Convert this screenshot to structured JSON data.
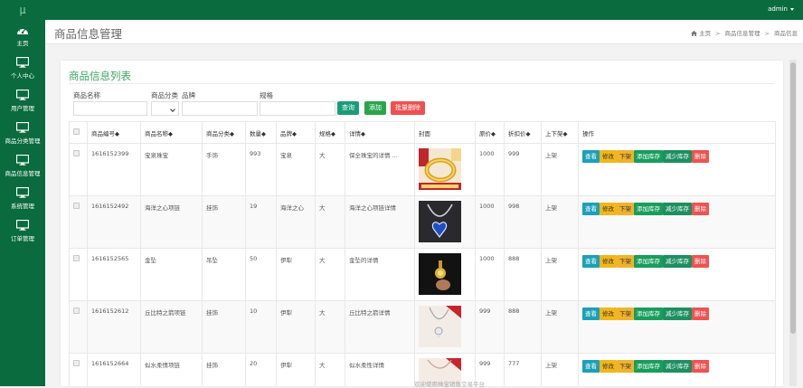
{
  "app": {
    "logo": "μ",
    "user": "admin"
  },
  "colors": {
    "brand": "#0a6b3e",
    "accent": "#3aa55e",
    "danger": "#ee4f4f"
  },
  "sidebar": {
    "items": [
      {
        "label": "主页",
        "icon": "dashboard-icon"
      },
      {
        "label": "个人中心",
        "icon": "monitor-icon"
      },
      {
        "label": "用户管理",
        "icon": "monitor-icon"
      },
      {
        "label": "商品分类管理",
        "icon": "monitor-icon"
      },
      {
        "label": "商品信息管理",
        "icon": "monitor-icon"
      },
      {
        "label": "系统管理",
        "icon": "monitor-icon"
      },
      {
        "label": "订单管理",
        "icon": "monitor-icon"
      }
    ]
  },
  "header": {
    "title": "商品信息管理",
    "breadcrumb": [
      "主页",
      "商品信息管理",
      "商品信息"
    ]
  },
  "card": {
    "title": "商品信息列表"
  },
  "filters": {
    "name_label": "商品名称",
    "name_value": "",
    "category_label": "商品分类",
    "category_value": "",
    "brand_label": "品牌",
    "brand_value": "",
    "spec_label": "规格",
    "spec_value": "",
    "query_button": "查询",
    "add_button": "添加",
    "batch_delete_button": "批量删除"
  },
  "table": {
    "headers": [
      "",
      "商品编号◆",
      "商品名称◆",
      "商品分类◆",
      "数量◆",
      "品牌◆",
      "规格◆",
      "详情◆",
      "封面",
      "原价◆",
      "折扣价◆",
      "上下架◆",
      "操作"
    ],
    "actions": [
      "查看",
      "修改",
      "下架",
      "添加库存",
      "减少库存",
      "删除"
    ],
    "rows": [
      {
        "id": "1616152399",
        "name": "宝泉珠宝",
        "category": "手饰",
        "qty": "993",
        "brand": "宝泉",
        "spec": "大",
        "detail": "保全珠宝的详情 ...",
        "price": "1000",
        "discount": "999",
        "status": "上架",
        "cover": "gold-bracelet"
      },
      {
        "id": "1616152492",
        "name": "海洋之心项链",
        "category": "挂饰",
        "qty": "19",
        "brand": "海洋之心",
        "spec": "大",
        "detail": "海洋之心项链详情",
        "price": "1000",
        "discount": "998",
        "status": "上架",
        "cover": "blue-heart-necklace"
      },
      {
        "id": "1616152565",
        "name": "金坠",
        "category": "吊坠",
        "qty": "50",
        "brand": "伊犁",
        "spec": "大",
        "detail": "金坠的详情",
        "price": "1000",
        "discount": "888",
        "status": "上架",
        "cover": "gold-pendant"
      },
      {
        "id": "1616152612",
        "name": "丘比特之箭项链",
        "category": "挂饰",
        "qty": "10",
        "brand": "伊犁",
        "spec": "大",
        "detail": "丘比特之箭详情",
        "price": "999",
        "discount": "888",
        "status": "上架",
        "cover": "silver-necklace"
      },
      {
        "id": "1616152664",
        "name": "似水柔情项链",
        "category": "挂饰",
        "qty": "20",
        "brand": "伊犁",
        "spec": "大",
        "detail": "似水柔性详情",
        "price": "999",
        "discount": "777",
        "status": "上架",
        "cover": "pink-necklace"
      }
    ]
  },
  "footer": {
    "text": "欢迎使用珠宝销售交易平台"
  }
}
